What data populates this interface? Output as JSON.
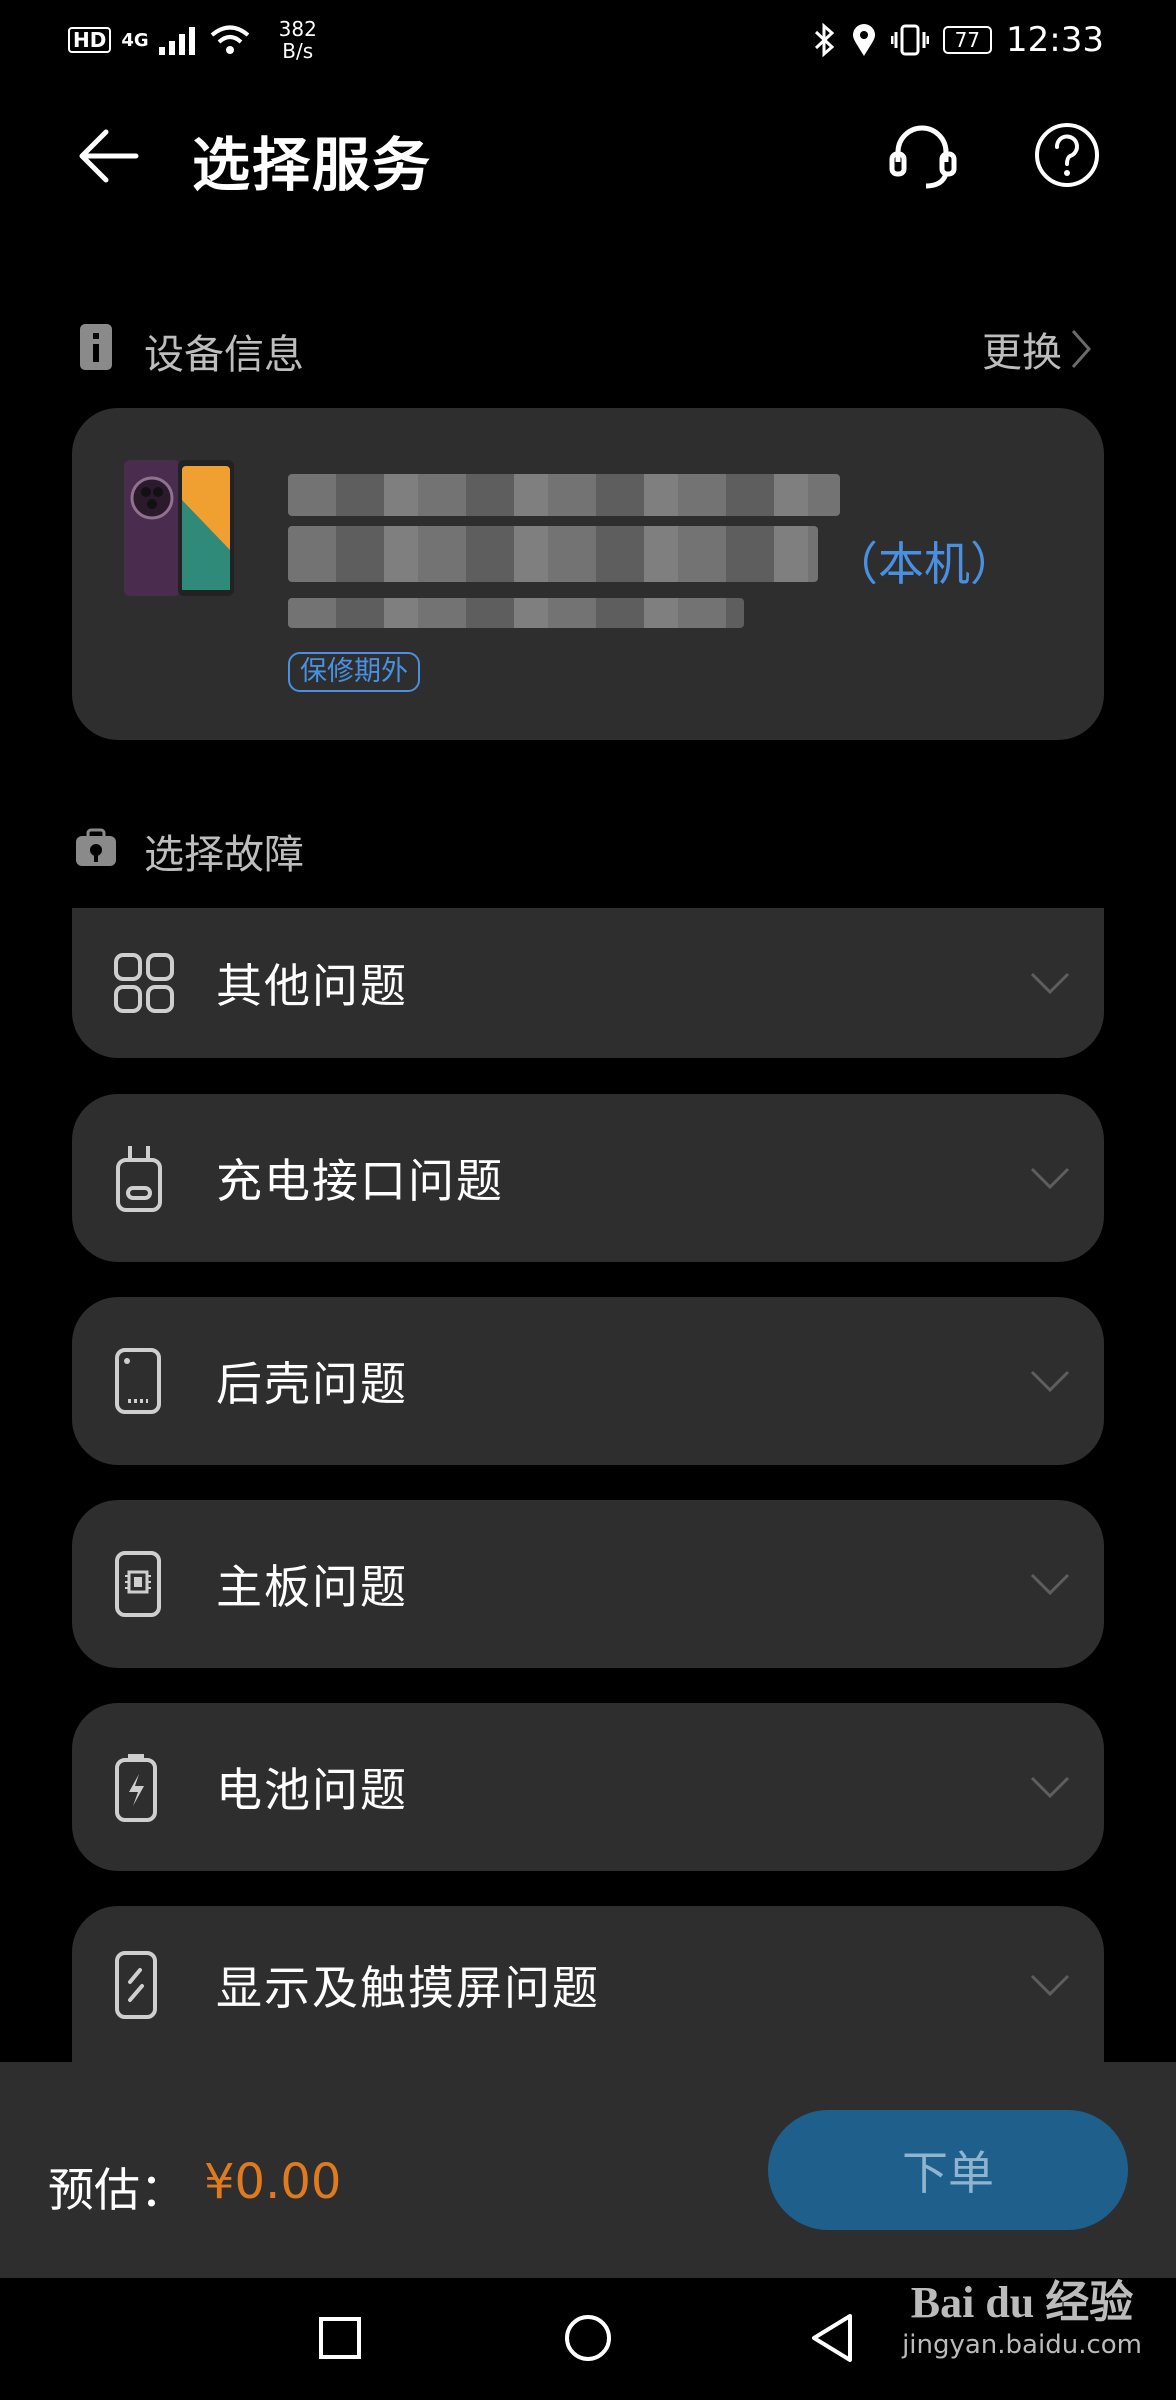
{
  "status_bar": {
    "hd": "HD",
    "network": "4G",
    "speed_value": "382",
    "speed_unit": "B/s",
    "battery": "77",
    "time": "12:33"
  },
  "header": {
    "title": "选择服务",
    "icons": [
      "back-arrow-icon",
      "customer-service-icon",
      "help-icon"
    ]
  },
  "device_section": {
    "label": "设备信息",
    "change_label": "更换",
    "this_device_label": "（本机）",
    "warranty_badge": "保修期外"
  },
  "fault_section": {
    "label": "选择故障",
    "items": [
      {
        "label": "其他问题",
        "icon": "grid-icon"
      },
      {
        "label": "充电接口问题",
        "icon": "charging-port-icon"
      },
      {
        "label": "后壳问题",
        "icon": "phone-back-icon"
      },
      {
        "label": "主板问题",
        "icon": "chip-icon"
      },
      {
        "label": "电池问题",
        "icon": "battery-icon"
      },
      {
        "label": "显示及触摸屏问题",
        "icon": "screen-icon"
      }
    ]
  },
  "footer": {
    "estimate_label": "预估：",
    "estimate_price": "¥0.00",
    "order_button": "下单"
  },
  "watermark": {
    "brand": "Bai du 经验",
    "url": "jingyan.baidu.com"
  },
  "colors": {
    "background": "#000000",
    "card": "#2e2e2e",
    "accent_blue": "#4a90e2",
    "price_orange": "#e07a1f",
    "button_blue": "#1e5f8c"
  }
}
